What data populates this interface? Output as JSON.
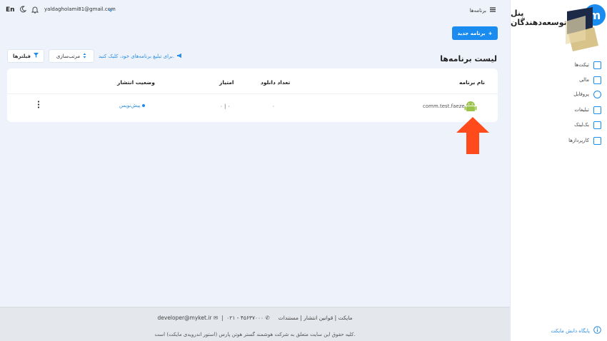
{
  "topbar": {
    "lang": "En",
    "email": "yaldagholami81@gmail.com",
    "page_title": "برنامه‌ها"
  },
  "actions": {
    "new_app": "برنامه جدید",
    "filters": "فیلترها",
    "sort": "مرتب‌سازی",
    "promo": "برای تبلیغ برنامه‌های خود، کلیک کنید."
  },
  "list": {
    "title": "لیست برنامه‌ها",
    "columns": {
      "app_name": "نام برنامه",
      "downloads": "تعداد دانلود",
      "rating": "امتیاز",
      "status": "وضعیت انتشار"
    },
    "rows": [
      {
        "package": "comm.test.faeze",
        "downloads": "۰",
        "rating": "۰ | ۰",
        "status": "پیش‌نویس"
      }
    ]
  },
  "footer": {
    "links": "مایکت | قوانین انتشار | مستندات",
    "phone": "۰۲۱ - ۴۵۶۳۷۰۰۰",
    "email": "developer@myket.ir",
    "copyright": "کلیه حقوق این سایت متعلق به شرکت هوشمند گستر هوتن پارس (استور اندرویدی مایکت) است."
  },
  "sidebar": {
    "title": "پنل توسعه‌دهندگان",
    "items": [
      {
        "label": "تیکت‌ها"
      },
      {
        "label": "مالی"
      },
      {
        "label": "پروفایل"
      },
      {
        "label": "تبلیغات"
      },
      {
        "label": "بک‌لینک"
      },
      {
        "label": "کارپردازها"
      }
    ],
    "knowledge_base": "پایگاه دانش مایکت"
  },
  "colors": {
    "accent": "#1a8cef",
    "arrow": "#ff4a1c",
    "android": "#9bc34a"
  }
}
